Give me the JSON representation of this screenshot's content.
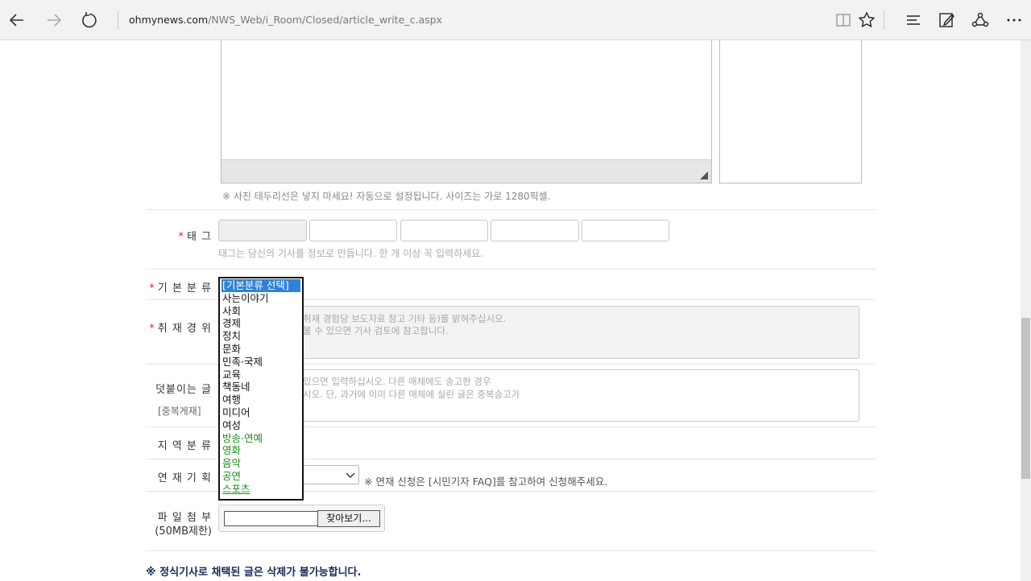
{
  "browser": {
    "url_host": "ohmynews.com",
    "url_path": "/NWS_Web/i_Room/Closed/article_write_c.aspx"
  },
  "photo_note": "※ 사진 테두리선은 넣지 마세요! 자동으로 설정됩니다. 사이즈는 가로 1280픽셀.",
  "tag": {
    "label": "태  그",
    "help": "태그는 당신의 기사를 정보로 만듭니다. 한 개 이상 꼭 입력하세요."
  },
  "category": {
    "label": "기 본 분 류",
    "options": [
      {
        "text": "[기본분류 선택]",
        "selected": true,
        "color": "#ffffff"
      },
      {
        "text": "사는이야기",
        "color": "#111111"
      },
      {
        "text": "사회",
        "color": "#111111"
      },
      {
        "text": "경제",
        "color": "#111111"
      },
      {
        "text": "정치",
        "color": "#111111"
      },
      {
        "text": "문화",
        "color": "#111111"
      },
      {
        "text": "민족·국제",
        "color": "#111111"
      },
      {
        "text": "교육",
        "color": "#111111"
      },
      {
        "text": "책동네",
        "color": "#111111"
      },
      {
        "text": "여행",
        "color": "#111111"
      },
      {
        "text": "미디어",
        "color": "#111111"
      },
      {
        "text": "여성",
        "color": "#111111"
      },
      {
        "text": "방송·연예",
        "color": "#1a8c1a"
      },
      {
        "text": "영화",
        "color": "#1a8c1a"
      },
      {
        "text": "음악",
        "color": "#1a8c1a"
      },
      {
        "text": "공연",
        "color": "#1a8c1a"
      },
      {
        "text": "스포츠",
        "color": "#1a8c1a"
      }
    ]
  },
  "coverage": {
    "label": "취 재 경 위",
    "placeholder_line1": "취재 경험당 보도자료 참고 기타 등)를 밝혀주십시오.",
    "placeholder_line2": "볼 수 있으면 기사 검토에 참고합니다."
  },
  "attach_text": {
    "label": "덧붙이는 글",
    "sublabel": "[중복게재]",
    "placeholder_line1": "있으면 입력하십시오. 다른 매체에도 송고한 경우",
    "placeholder_line2": "시오. 단, 과거에 이미 다른 매체에 실린 글은 중복송고가"
  },
  "region": {
    "label": "지 역 분 류"
  },
  "series": {
    "label": "연 재 기 획",
    "note": "※ 연재 신청은 [시민기자 FAQ]를 참고하여 신청해주세요."
  },
  "file": {
    "label": "파 일 첨 부",
    "sublabel": "(50MB제한)",
    "button": "찾아보기..."
  },
  "warning": "※ 정식기사로 채택된 글은 삭제가 불가능합니다."
}
